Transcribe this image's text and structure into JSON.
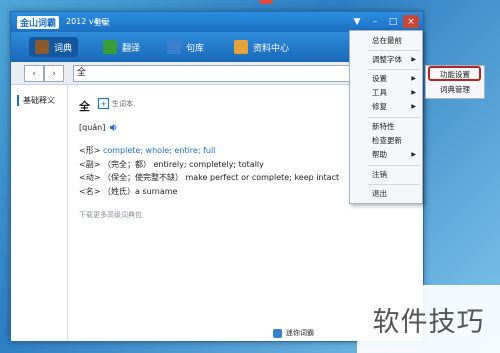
{
  "app": {
    "logo": "金山词霸",
    "version": "2012 v4.6",
    "login": "登录"
  },
  "window_buttons": {
    "menu": "▼",
    "minimize": "–",
    "maximize": "□",
    "close": "×"
  },
  "nav": {
    "tabs": [
      {
        "label": "词典",
        "icon": "dictionary-icon",
        "color": "#8a5a2e"
      },
      {
        "label": "翻译",
        "icon": "translate-icon",
        "color": "#3a9c3a"
      },
      {
        "label": "句库",
        "icon": "sentences-icon",
        "color": "#3a7fd0"
      },
      {
        "label": "资料中心",
        "icon": "resources-icon",
        "color": "#e4a23a"
      }
    ]
  },
  "search": {
    "back": "‹",
    "forward": "›",
    "value": "全"
  },
  "sidebar": {
    "item": "基础释义"
  },
  "entry": {
    "word": "全",
    "add_label": "生词本",
    "pinyin": "[quán]",
    "definitions": [
      {
        "pos": "<形>",
        "text": "complete; whole; entire; full"
      },
      {
        "pos": "<副>",
        "text": "（完全；都） entirely; completely; totally"
      },
      {
        "pos": "<动>",
        "text": "（保全；使完整不缺） make perfect or complete; keep intact"
      },
      {
        "pos": "<名>",
        "text": "（姓氏）a surname"
      }
    ],
    "more": "下载更多高级词典包"
  },
  "bottom": {
    "label": "迷你词霸"
  },
  "menu": {
    "items": [
      {
        "label": "总在最前",
        "submenu": false
      },
      {
        "label": "调整字体",
        "submenu": true
      },
      {
        "label": "设置",
        "submenu": true
      },
      {
        "label": "工具",
        "submenu": true
      },
      {
        "label": "修复",
        "submenu": true
      },
      {
        "label": "新特性",
        "submenu": false
      },
      {
        "label": "检查更新",
        "submenu": false
      },
      {
        "label": "帮助",
        "submenu": true
      },
      {
        "label": "注销",
        "submenu": false
      },
      {
        "label": "退出",
        "submenu": false
      }
    ]
  },
  "submenu": {
    "items": [
      "功能设置",
      "词典管理"
    ]
  },
  "watermark": "软件技巧"
}
